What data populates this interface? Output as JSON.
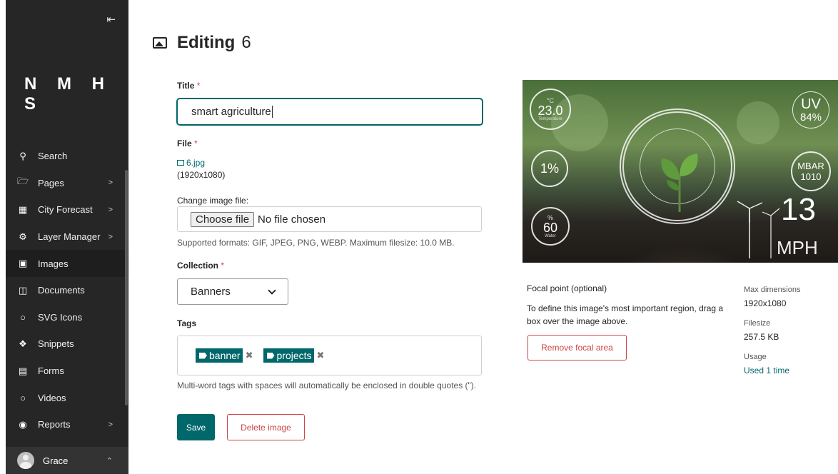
{
  "sidebar": {
    "collapse_glyph": "⇤",
    "logo": "N M H S",
    "items": [
      {
        "label": "Search",
        "icon": "search-icon",
        "chevron": false
      },
      {
        "label": "Pages",
        "icon": "folder-icon",
        "chevron": true
      },
      {
        "label": "City Forecast",
        "icon": "table-icon",
        "chevron": true
      },
      {
        "label": "Layer Manager",
        "icon": "cog-icon",
        "chevron": true
      },
      {
        "label": "Images",
        "icon": "image-icon",
        "chevron": false,
        "active": true
      },
      {
        "label": "Documents",
        "icon": "document-icon",
        "chevron": false
      },
      {
        "label": "SVG Icons",
        "icon": "circle-icon",
        "chevron": false
      },
      {
        "label": "Snippets",
        "icon": "snippet-icon",
        "chevron": false
      },
      {
        "label": "Forms",
        "icon": "form-icon",
        "chevron": false
      },
      {
        "label": "Videos",
        "icon": "circle-icon",
        "chevron": false
      },
      {
        "label": "Reports",
        "icon": "globe-icon",
        "chevron": true
      }
    ],
    "account": {
      "name": "Grace"
    }
  },
  "header": {
    "title": "Editing",
    "number": "6"
  },
  "form": {
    "title_label": "Title",
    "title_value": "smart agriculture",
    "file_label": "File",
    "file_name": "6.jpg",
    "file_dims": "(1920x1080)",
    "change_label": "Change image file:",
    "choose_button": "Choose file",
    "no_file": "No file chosen",
    "formats_help": "Supported formats: GIF, JPEG, PNG, WEBP. Maximum filesize: 10.0 MB.",
    "collection_label": "Collection",
    "collection_value": "Banners",
    "tags_label": "Tags",
    "tags": [
      "banner",
      "projects"
    ],
    "tags_help": "Multi-word tags with spaces will automatically be enclosed in double quotes (\").",
    "required_mark": "*",
    "save_label": "Save",
    "delete_label": "Delete image"
  },
  "preview": {
    "temp_value": "23.0",
    "temp_unit": "°C",
    "temp_caption": "Temperature",
    "pct_value": "1%",
    "water_unit": "%",
    "water_value": "60",
    "water_caption": "Water",
    "uv_label": "UV",
    "uv_value": "84%",
    "mbar_label": "MBAR",
    "mbar_value": "1010",
    "wind_value": "13",
    "wind_unit": "MPH"
  },
  "focal": {
    "title": "Focal point",
    "optional": "(optional)",
    "description": "To define this image's most important region, drag a box over the image above.",
    "remove_button": "Remove focal area"
  },
  "meta": {
    "max_dims_label": "Max dimensions",
    "max_dims_value": "1920x1080",
    "filesize_label": "Filesize",
    "filesize_value": "257.5 KB",
    "usage_label": "Usage",
    "usage_value": "Used 1 time"
  },
  "colors": {
    "primary": "#00676a",
    "danger": "#cd4444",
    "sidebar": "#262626"
  }
}
